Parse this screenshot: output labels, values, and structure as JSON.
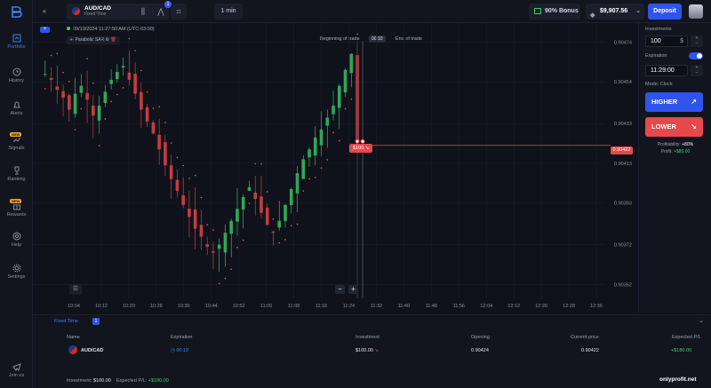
{
  "sidebar": {
    "items": [
      {
        "label": "Portfolio",
        "icon": "portfolio-icon"
      },
      {
        "label": "History",
        "icon": "history-icon"
      },
      {
        "label": "Alerts",
        "icon": "alerts-icon"
      },
      {
        "label": "Signals",
        "icon": "signals-icon",
        "badge": "NEW"
      },
      {
        "label": "Ranking",
        "icon": "trophy-icon"
      },
      {
        "label": "Rewards",
        "icon": "gift-icon",
        "badge": "NEW"
      },
      {
        "label": "Help",
        "icon": "help-icon"
      },
      {
        "label": "Settings",
        "icon": "gear-icon"
      },
      {
        "label": "Join us",
        "icon": "telegram-icon"
      }
    ]
  },
  "topbar": {
    "asset_name": "AUD/CAD",
    "asset_sub": "Fixed Time",
    "tool_badge": "1",
    "timeframe": "1 min",
    "bonus": "90% Bonus",
    "balance": "$9,907.56",
    "deposit_label": "Deposit"
  },
  "chart": {
    "datetime": "09/10/2024 11:27:50 AM (UTC-03:00)",
    "indicator": "Parabolic SAR",
    "beginning_label": "Beginning of trade",
    "timer": "00:10",
    "end_label": "End of trade",
    "current_price": "0.90422",
    "trade_label": "$100"
  },
  "chart_data": {
    "type": "candlestick",
    "x_ticks": [
      "10:04",
      "10:12",
      "10:20",
      "10:28",
      "10:36",
      "10:44",
      "10:52",
      "11:00",
      "11:08",
      "11:16",
      "11:24",
      "11:32",
      "11:40",
      "11:48",
      "11:56",
      "12:04",
      "12:12",
      "12:20",
      "12:28",
      "12:36"
    ],
    "y_ticks": [
      "0.90474",
      "0.90454",
      "0.90433",
      "0.90413",
      "0.90393",
      "0.90372",
      "0.90352"
    ],
    "ylim": [
      0.90345,
      0.9048
    ],
    "current_price": 0.90422,
    "trade_open_price": 0.90424,
    "parabolic_sar": true
  },
  "panel": {
    "investment_label": "Investments",
    "investment_value": "100",
    "investment_unit": "$",
    "expiration_label": "Expiration",
    "expiration_value": "11:29:00",
    "mode_label": "Mode: Clock",
    "higher_label": "HIGHER",
    "lower_label": "LOWER",
    "profitability_label": "Profitability:",
    "profitability_value": "+80%",
    "profit_label": "Profit:",
    "profit_value": "+$80.00"
  },
  "trades": {
    "tab_label": "Fixed Time",
    "count": "1",
    "columns": [
      "Name",
      "Expiration",
      "Investment",
      "Opening",
      "Current price",
      "Expected P/L"
    ],
    "rows": [
      {
        "name": "AUD/CAD",
        "expiration": "00:10",
        "investment": "$100.00",
        "opening": "0.90424",
        "current": "0.90422",
        "pl": "+$180.00"
      }
    ],
    "footer_investment_label": "Investment:",
    "footer_investment_value": "$100.00",
    "footer_pl_label": "Expected P/L:",
    "footer_pl_value": "+$180.00"
  },
  "watermark": "onlyprofit.net",
  "colors": {
    "accent": "#2f54eb",
    "up": "#3ecf6e",
    "down": "#e5484d",
    "background": "#0f121a"
  }
}
